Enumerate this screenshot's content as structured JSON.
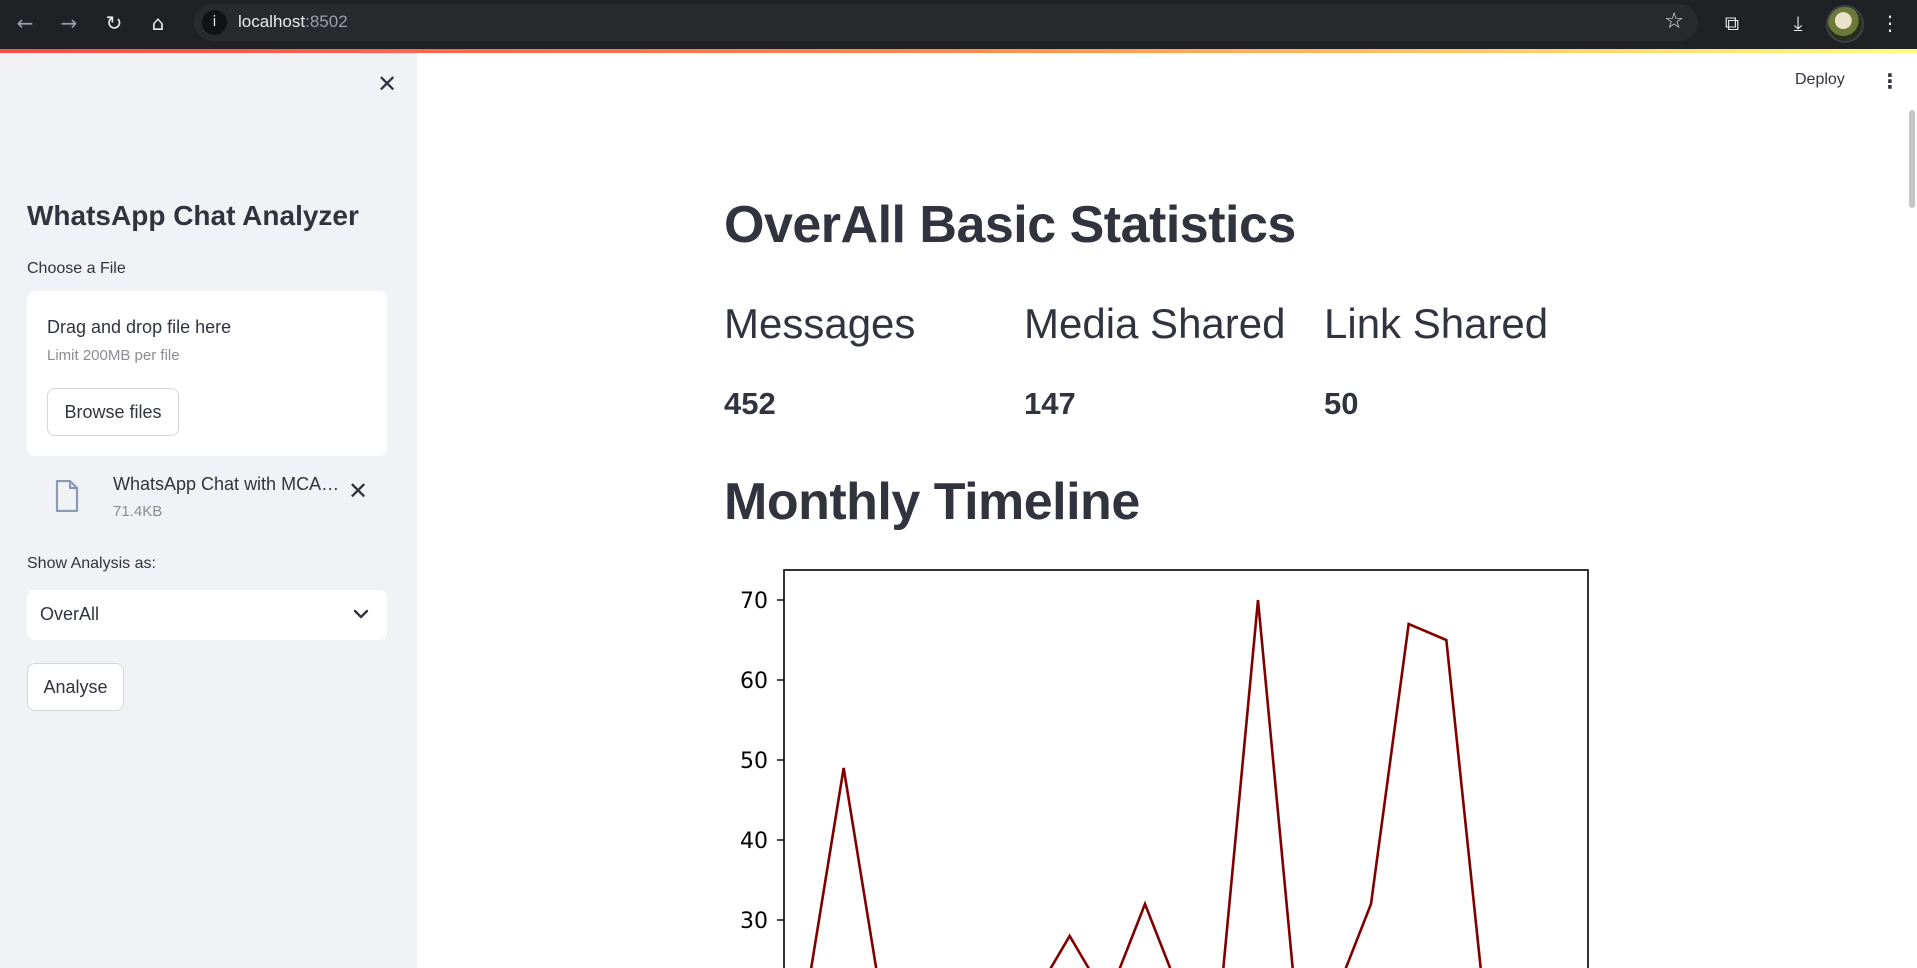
{
  "browser": {
    "url_host": "localhost",
    "url_port": ":8502",
    "icons": [
      "back-icon",
      "forward-icon",
      "reload-icon",
      "home-icon",
      "site-info-icon",
      "bookmark-star-icon",
      "extensions-icon",
      "download-icon",
      "profile-avatar"
    ]
  },
  "sidebar": {
    "close_glyph": "✕",
    "title": "WhatsApp Chat Analyzer",
    "file_label": "Choose a File",
    "uploader": {
      "drag_text": "Drag and drop file here",
      "limit_text": "Limit 200MB per file",
      "browse_label": "Browse files"
    },
    "uploaded_file": {
      "name": "WhatsApp Chat with MCA…",
      "size": "71.4KB",
      "remove_glyph": "✕"
    },
    "analysis_label": "Show Analysis as:",
    "analysis_select": {
      "value": "OverAll"
    },
    "analyse_label": "Analyse"
  },
  "header": {
    "deploy_label": "Deploy",
    "menu_glyph": "⋮"
  },
  "main": {
    "stats_title": "OverAll Basic Statistics",
    "stats": [
      {
        "label": "Messages",
        "value": "452"
      },
      {
        "label": "Media Shared",
        "value": "147"
      },
      {
        "label": "Link Shared",
        "value": "50"
      }
    ],
    "timeline_title": "Monthly Timeline"
  },
  "chart_data": {
    "type": "line",
    "title": "",
    "xlabel": "",
    "ylabel": "",
    "ylim_visible": [
      23,
      73
    ],
    "ylim": [
      0,
      73
    ],
    "yticks": [
      30,
      40,
      50,
      60,
      70
    ],
    "series": [
      {
        "color": "#800000",
        "values": [
          20,
          49,
          20,
          20,
          20,
          20,
          20,
          28,
          20,
          32,
          20,
          20,
          70,
          20,
          20,
          32,
          67,
          65,
          20
        ]
      }
    ],
    "grid": false
  }
}
